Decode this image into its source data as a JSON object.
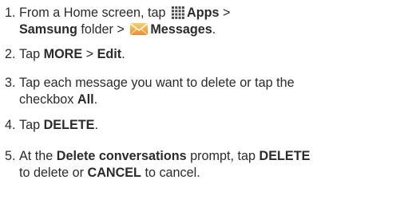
{
  "steps": [
    {
      "number": "1.",
      "line1": {
        "t1": "From a Home screen, tap ",
        "icon1": "apps-grid-icon",
        "b1": "Apps",
        "t2": " >"
      },
      "line2": {
        "b2": "Samsung",
        "t3": " folder > ",
        "icon2": "messages-envelope-icon",
        "b3": "Messages",
        "t4": "."
      }
    },
    {
      "number": "2.",
      "t1": "Tap ",
      "b1": "MORE",
      "t2": " > ",
      "b2": "Edit",
      "t3": "."
    },
    {
      "number": "3.",
      "line1": "Tap each message you want to delete or tap the",
      "line2": {
        "t1": "checkbox ",
        "b1": "All",
        "t2": "."
      }
    },
    {
      "number": "4.",
      "t1": "Tap ",
      "b1": "DELETE",
      "t2": "."
    },
    {
      "number": "5.",
      "line1": {
        "t1": "At the ",
        "b1": "Delete conversations",
        "t2": " prompt, tap ",
        "b2": "DELETE"
      },
      "line2": {
        "t1": "to delete or ",
        "b1": "CANCEL",
        "t2": " to cancel."
      }
    }
  ],
  "colors": {
    "text": "#2b2b2b",
    "apps_icon": "#4a4a4a",
    "messages_icon_top": "#f5d36b",
    "messages_icon_bottom": "#f28a2e"
  }
}
